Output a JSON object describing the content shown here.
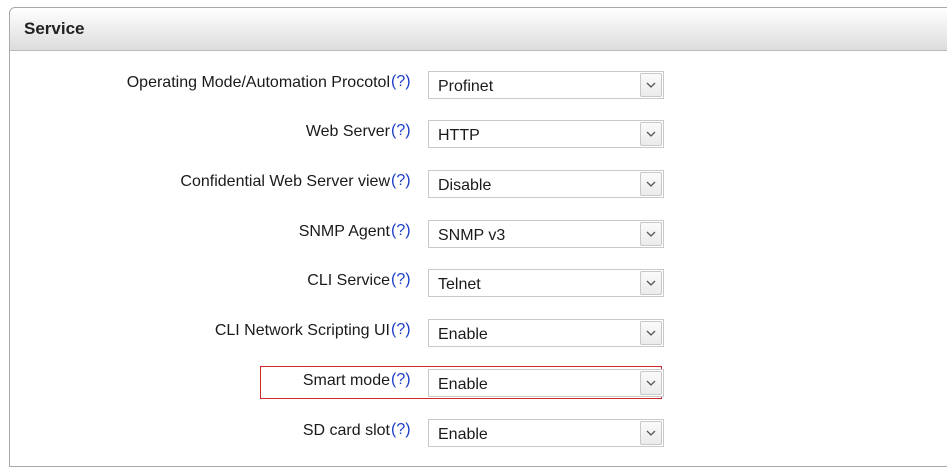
{
  "panel": {
    "title": "Service"
  },
  "help_text": "(?)",
  "rows": [
    {
      "label": "Operating Mode/Automation Procotol",
      "value": "Profinet"
    },
    {
      "label": "Web Server",
      "value": "HTTP"
    },
    {
      "label": "Confidential Web Server view",
      "value": "Disable"
    },
    {
      "label": "SNMP Agent",
      "value": "SNMP v3"
    },
    {
      "label": "CLI Service",
      "value": "Telnet"
    },
    {
      "label": "CLI Network Scripting UI",
      "value": "Enable"
    },
    {
      "label": "Smart mode",
      "value": "Enable",
      "highlighted": true
    },
    {
      "label": "SD card slot",
      "value": "Enable"
    }
  ],
  "icons": {
    "dropdown": "chevron-down-icon"
  },
  "colors": {
    "help_link": "#1b3ec9",
    "highlight_border": "#cc2a2a"
  }
}
